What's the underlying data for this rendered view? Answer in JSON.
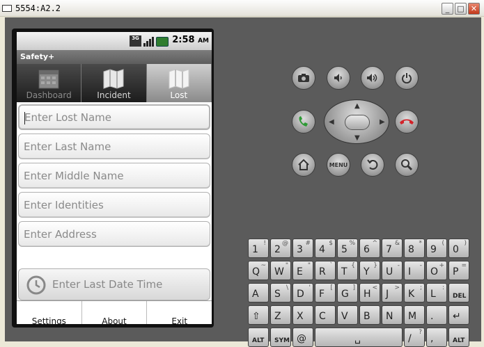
{
  "window": {
    "title": "5554:A2.2",
    "minimize": "_",
    "maximize": "□",
    "close": "✕"
  },
  "status": {
    "network": "3G",
    "time": "2:58",
    "ampm": "AM"
  },
  "app": {
    "title": "Safety+"
  },
  "tabs": [
    {
      "label": "Dashboard",
      "icon": "calendar-icon"
    },
    {
      "label": "Incident",
      "icon": "map-icon"
    },
    {
      "label": "Lost",
      "icon": "map-icon"
    }
  ],
  "form": {
    "lost_name_placeholder": "Enter Lost Name",
    "last_name_placeholder": "Enter Last Name",
    "middle_name_placeholder": "Enter Middle Name",
    "identities_placeholder": "Enter Identities",
    "address_placeholder": "Enter Address",
    "date_label": "Enter Last Date Time"
  },
  "menu": {
    "settings": "Settings",
    "about": "About",
    "exit": "Exit"
  },
  "controls": {
    "menu_label": "MENU"
  },
  "keyboard": {
    "row1": [
      [
        "1",
        "!"
      ],
      [
        "2",
        "@"
      ],
      [
        "3",
        "#"
      ],
      [
        "4",
        "$"
      ],
      [
        "5",
        "%"
      ],
      [
        "6",
        "^"
      ],
      [
        "7",
        "&"
      ],
      [
        "8",
        "*"
      ],
      [
        "9",
        "("
      ],
      [
        "0",
        ")"
      ]
    ],
    "row2": [
      [
        "Q",
        "~"
      ],
      [
        "W",
        "\""
      ],
      [
        "E",
        "\""
      ],
      [
        "R",
        "`"
      ],
      [
        "T",
        "{"
      ],
      [
        "Y",
        "}"
      ],
      [
        "U",
        "-"
      ],
      [
        "I",
        "-"
      ],
      [
        "O",
        "+"
      ],
      [
        "P",
        "="
      ]
    ],
    "row3": [
      [
        "A",
        ""
      ],
      [
        "S",
        "\\"
      ],
      [
        "D",
        "'"
      ],
      [
        "F",
        "["
      ],
      [
        "G",
        "]"
      ],
      [
        "H",
        "<"
      ],
      [
        "J",
        ">"
      ],
      [
        "K",
        ";"
      ],
      [
        "L",
        ":"
      ],
      [
        "DEL",
        ""
      ]
    ],
    "row4": [
      [
        "⇧",
        ""
      ],
      [
        "Z",
        ""
      ],
      [
        "X",
        ""
      ],
      [
        "C",
        ""
      ],
      [
        "V",
        ""
      ],
      [
        "B",
        ""
      ],
      [
        "N",
        ""
      ],
      [
        "M",
        ""
      ],
      [
        ".",
        ""
      ],
      [
        "↵",
        ""
      ]
    ],
    "row5": [
      [
        "ALT",
        ""
      ],
      [
        "SYM",
        ""
      ],
      [
        "@",
        ""
      ],
      [
        "␣",
        ""
      ],
      [
        "/",
        "?"
      ],
      [
        ",",
        ""
      ],
      [
        "ALT",
        ""
      ]
    ]
  },
  "colors": {
    "emu_bg": "#5b5b5b",
    "call_green": "#2e9a35",
    "end_red": "#d2232a"
  }
}
